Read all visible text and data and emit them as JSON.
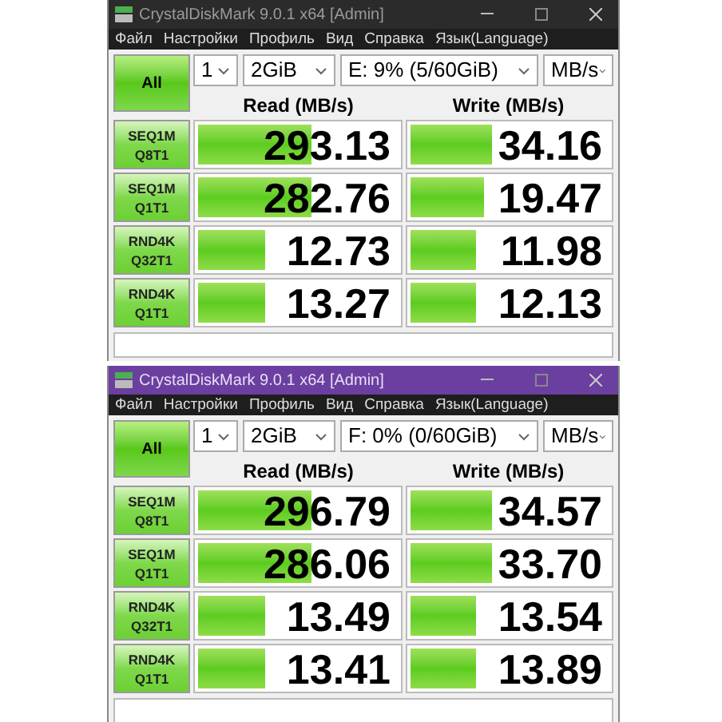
{
  "windows": [
    {
      "title": "CrystalDiskMark 9.0.1 x64 [Admin]",
      "active": false,
      "menu": [
        "Файл",
        "Настройки",
        "Профиль",
        "Вид",
        "Справка",
        "Язык(Language)"
      ],
      "all_button": "All",
      "count": "1",
      "size": "2GiB",
      "drive": "E: 9% (5/60GiB)",
      "unit": "MB/s",
      "read_header": "Read (MB/s)",
      "write_header": "Write (MB/s)",
      "rows": [
        {
          "test": [
            "SEQ1M",
            "Q8T1"
          ],
          "read": {
            "value": "293.13",
            "level": 0.57
          },
          "write": {
            "value": "34.16",
            "level": 0.42
          }
        },
        {
          "test": [
            "SEQ1M",
            "Q1T1"
          ],
          "read": {
            "value": "282.76",
            "level": 0.57
          },
          "write": {
            "value": "19.47",
            "level": 0.38
          }
        },
        {
          "test": [
            "RND4K",
            "Q32T1"
          ],
          "read": {
            "value": "12.73",
            "level": 0.34
          },
          "write": {
            "value": "11.98",
            "level": 0.34
          }
        },
        {
          "test": [
            "RND4K",
            "Q1T1"
          ],
          "read": {
            "value": "13.27",
            "level": 0.34
          },
          "write": {
            "value": "12.13",
            "level": 0.34
          }
        }
      ]
    },
    {
      "title": "CrystalDiskMark 9.0.1 x64 [Admin]",
      "active": true,
      "menu": [
        "Файл",
        "Настройки",
        "Профиль",
        "Вид",
        "Справка",
        "Язык(Language)"
      ],
      "all_button": "All",
      "count": "1",
      "size": "2GiB",
      "drive": "F: 0% (0/60GiB)",
      "unit": "MB/s",
      "read_header": "Read (MB/s)",
      "write_header": "Write (MB/s)",
      "rows": [
        {
          "test": [
            "SEQ1M",
            "Q8T1"
          ],
          "read": {
            "value": "296.79",
            "level": 0.57
          },
          "write": {
            "value": "34.57",
            "level": 0.42
          }
        },
        {
          "test": [
            "SEQ1M",
            "Q1T1"
          ],
          "read": {
            "value": "286.06",
            "level": 0.57
          },
          "write": {
            "value": "33.70",
            "level": 0.42
          }
        },
        {
          "test": [
            "RND4K",
            "Q32T1"
          ],
          "read": {
            "value": "13.49",
            "level": 0.34
          },
          "write": {
            "value": "13.54",
            "level": 0.34
          }
        },
        {
          "test": [
            "RND4K",
            "Q1T1"
          ],
          "read": {
            "value": "13.41",
            "level": 0.34
          },
          "write": {
            "value": "13.89",
            "level": 0.34
          }
        }
      ]
    }
  ]
}
